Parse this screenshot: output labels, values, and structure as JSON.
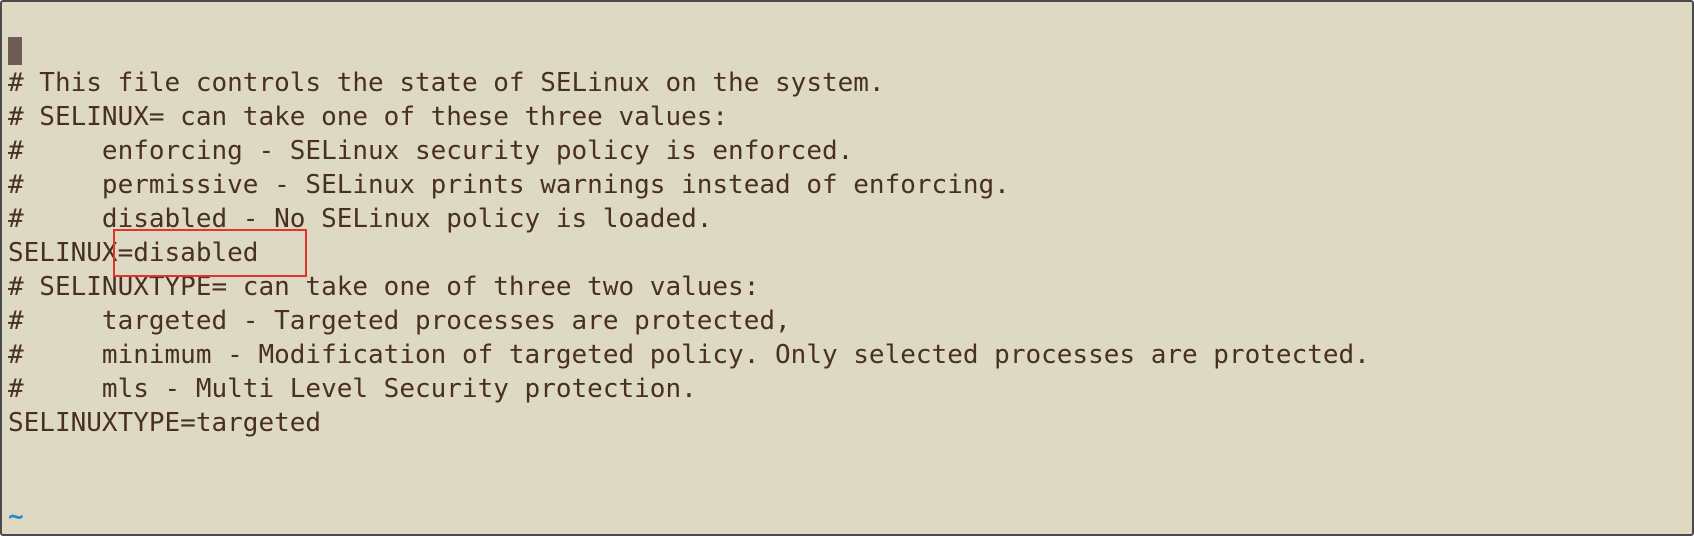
{
  "editor": {
    "lines": [
      "",
      "# This file controls the state of SELinux on the system.",
      "# SELINUX= can take one of these three values:",
      "#     enforcing - SELinux security policy is enforced.",
      "#     permissive - SELinux prints warnings instead of enforcing.",
      "#     disabled - No SELinux policy is loaded.",
      "SELINUX=disabled",
      "# SELINUXTYPE= can take one of three two values:",
      "#     targeted - Targeted processes are protected,",
      "#     minimum - Modification of targeted policy. Only selected processes are protected.",
      "#     mls - Multi Level Security protection.",
      "SELINUXTYPE=targeted"
    ],
    "empty_line_marker": "~"
  },
  "colors": {
    "background": "#ddd9c2",
    "text": "#4a2f24",
    "cursor": "#6e5c55",
    "tilde": "#2f86d6",
    "highlight": "#e2332d"
  }
}
